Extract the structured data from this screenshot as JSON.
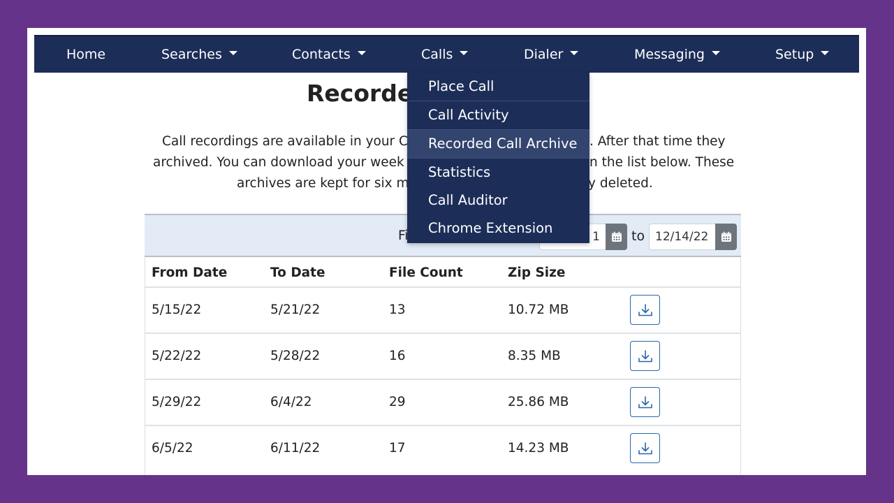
{
  "colors": {
    "background": "#65338a",
    "navbar": "#1c2d58",
    "dropdown_active": "#33456e",
    "filter_bar": "#e2ebf6",
    "download_accent": "#2766ad",
    "calendar_button": "#6e747c"
  },
  "nav": {
    "items": [
      {
        "label": "Home",
        "has_dropdown": false
      },
      {
        "label": "Searches",
        "has_dropdown": true
      },
      {
        "label": "Contacts",
        "has_dropdown": true
      },
      {
        "label": "Calls",
        "has_dropdown": true
      },
      {
        "label": "Dialer",
        "has_dropdown": true
      },
      {
        "label": "Messaging",
        "has_dropdown": true
      },
      {
        "label": "Setup",
        "has_dropdown": true
      }
    ]
  },
  "calls_menu": {
    "items": [
      {
        "label": "Place Call"
      },
      {
        "label": "Call Activity"
      },
      {
        "label": "Recorded Call Archive",
        "active": true
      },
      {
        "label": "Statistics"
      },
      {
        "label": "Call Auditor"
      },
      {
        "label": "Chrome Extension"
      }
    ]
  },
  "page": {
    "title_visible": "Recorde",
    "intro_lines": [
      {
        "left": "Call recordings are available in your C",
        "right": ". After that time they"
      },
      {
        "left": "archived. You can download your week",
        "right": "n the list below. These"
      },
      {
        "left": "archives are kept for six m",
        "right": "y deleted."
      }
    ]
  },
  "filter": {
    "label_visible": "Fi",
    "from_date_visible": "1",
    "to_label": "to",
    "to_date": "12/14/22"
  },
  "table": {
    "headers": [
      "From Date",
      "To Date",
      "File Count",
      "Zip Size",
      ""
    ],
    "rows": [
      {
        "from": "5/15/22",
        "to": "5/21/22",
        "count": "13",
        "size": "10.72 MB"
      },
      {
        "from": "5/22/22",
        "to": "5/28/22",
        "count": "16",
        "size": "8.35 MB"
      },
      {
        "from": "5/29/22",
        "to": "6/4/22",
        "count": "29",
        "size": "25.86 MB"
      },
      {
        "from": "6/5/22",
        "to": "6/11/22",
        "count": "17",
        "size": "14.23 MB"
      }
    ],
    "row_action_icon": "download-icon"
  }
}
